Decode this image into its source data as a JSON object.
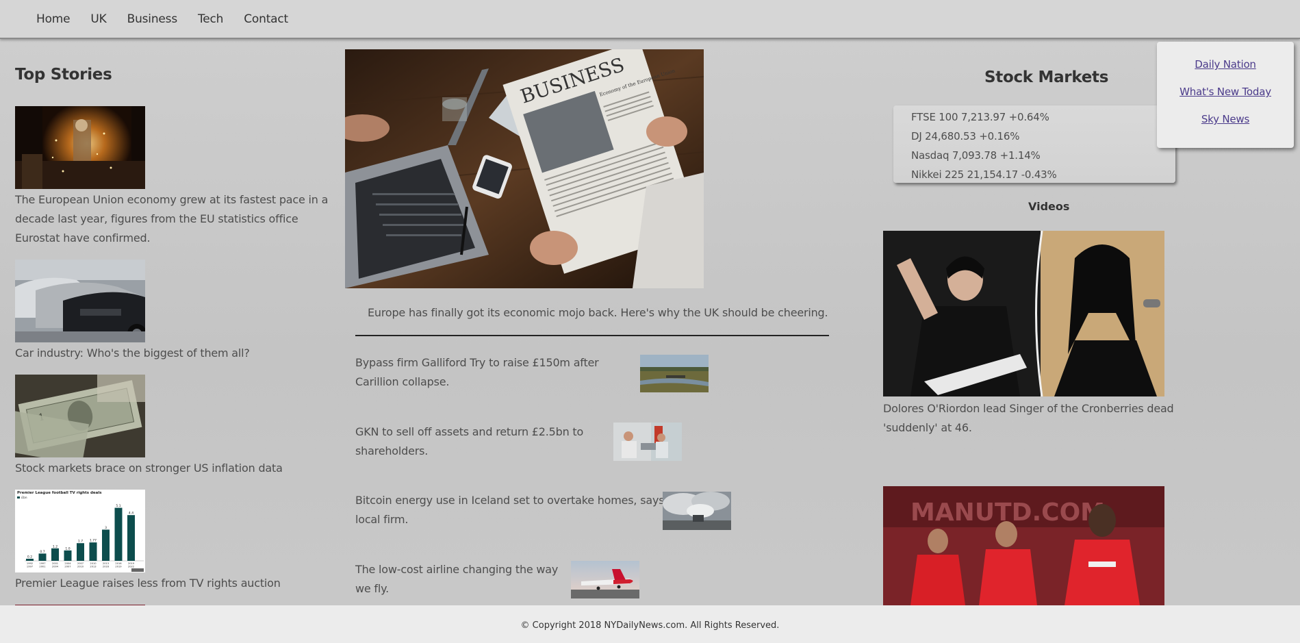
{
  "nav": {
    "items": [
      "Home",
      "UK",
      "Business",
      "Tech",
      "Contact"
    ]
  },
  "left": {
    "heading": "Top Stories",
    "stories": [
      {
        "text": "The European Union economy grew at its fastest pace in a decade last year, figures from the EU statistics office Eurostat have confirmed.",
        "icon": "steelworks-photo"
      },
      {
        "text": "Car industry: Who's the biggest of them all?",
        "icon": "cars-photo"
      },
      {
        "text": "Stock markets brace on stronger US inflation data",
        "icon": "dollar-bills-photo"
      },
      {
        "text": "Premier League raises less from TV rights auction",
        "icon": "tv-rights-chart-image"
      }
    ],
    "chart_image": {
      "title": "Premier League football TV rights deals",
      "legend": "£bn",
      "labels": [
        "0.2",
        "0.7",
        "1.2",
        "1.0",
        "1.7",
        "1.77",
        "3",
        "5.1",
        "4.4"
      ],
      "years": [
        "1992-1997",
        "1997-2001",
        "2001-2004",
        "2004-2007",
        "2007-2010",
        "2010-2013",
        "2013-2016",
        "2016-2019",
        "2019-2022"
      ]
    }
  },
  "center": {
    "hero_caption": "Europe has finally got its economic mojo back. Here's why the UK should be cheering.",
    "newspaper_headline": "BUSINESS",
    "newspaper_sub": "Economy of the European Union",
    "items": [
      {
        "text": "Bypass firm Galliford Try to raise £150m after Carillion collapse.",
        "icon": "river-bridge-photo"
      },
      {
        "text": "GKN to sell off assets and return £2.5bn to shareholders.",
        "icon": "factory-workers-photo"
      },
      {
        "text": "Bitcoin energy use in Iceland set to overtake homes, says local firm.",
        "icon": "geothermal-plant-photo"
      },
      {
        "text": "The low-cost airline changing the way we fly.",
        "icon": "airplane-photo"
      }
    ]
  },
  "right": {
    "stock_title": "Stock Markets",
    "stocks": [
      "FTSE 100 7,213.97 +0.64%",
      "DJ 24,680.53 +0.16%",
      "Nasdaq 7,093.78 +1.14%",
      "Nikkei 225 21,154.17 -0.43%"
    ],
    "videos_label": "Videos",
    "video_caption": "Dolores O'Riordon lead Singer of the Cronberries dead 'suddenly' at 46.",
    "video_banner": "MANUTD.COM"
  },
  "dropdown": {
    "links": [
      "Daily Nation",
      "What's New Today",
      "Sky News"
    ]
  },
  "footer": {
    "text": "© Copyright 2018 NYDailyNews.com. All Rights Reserved."
  }
}
